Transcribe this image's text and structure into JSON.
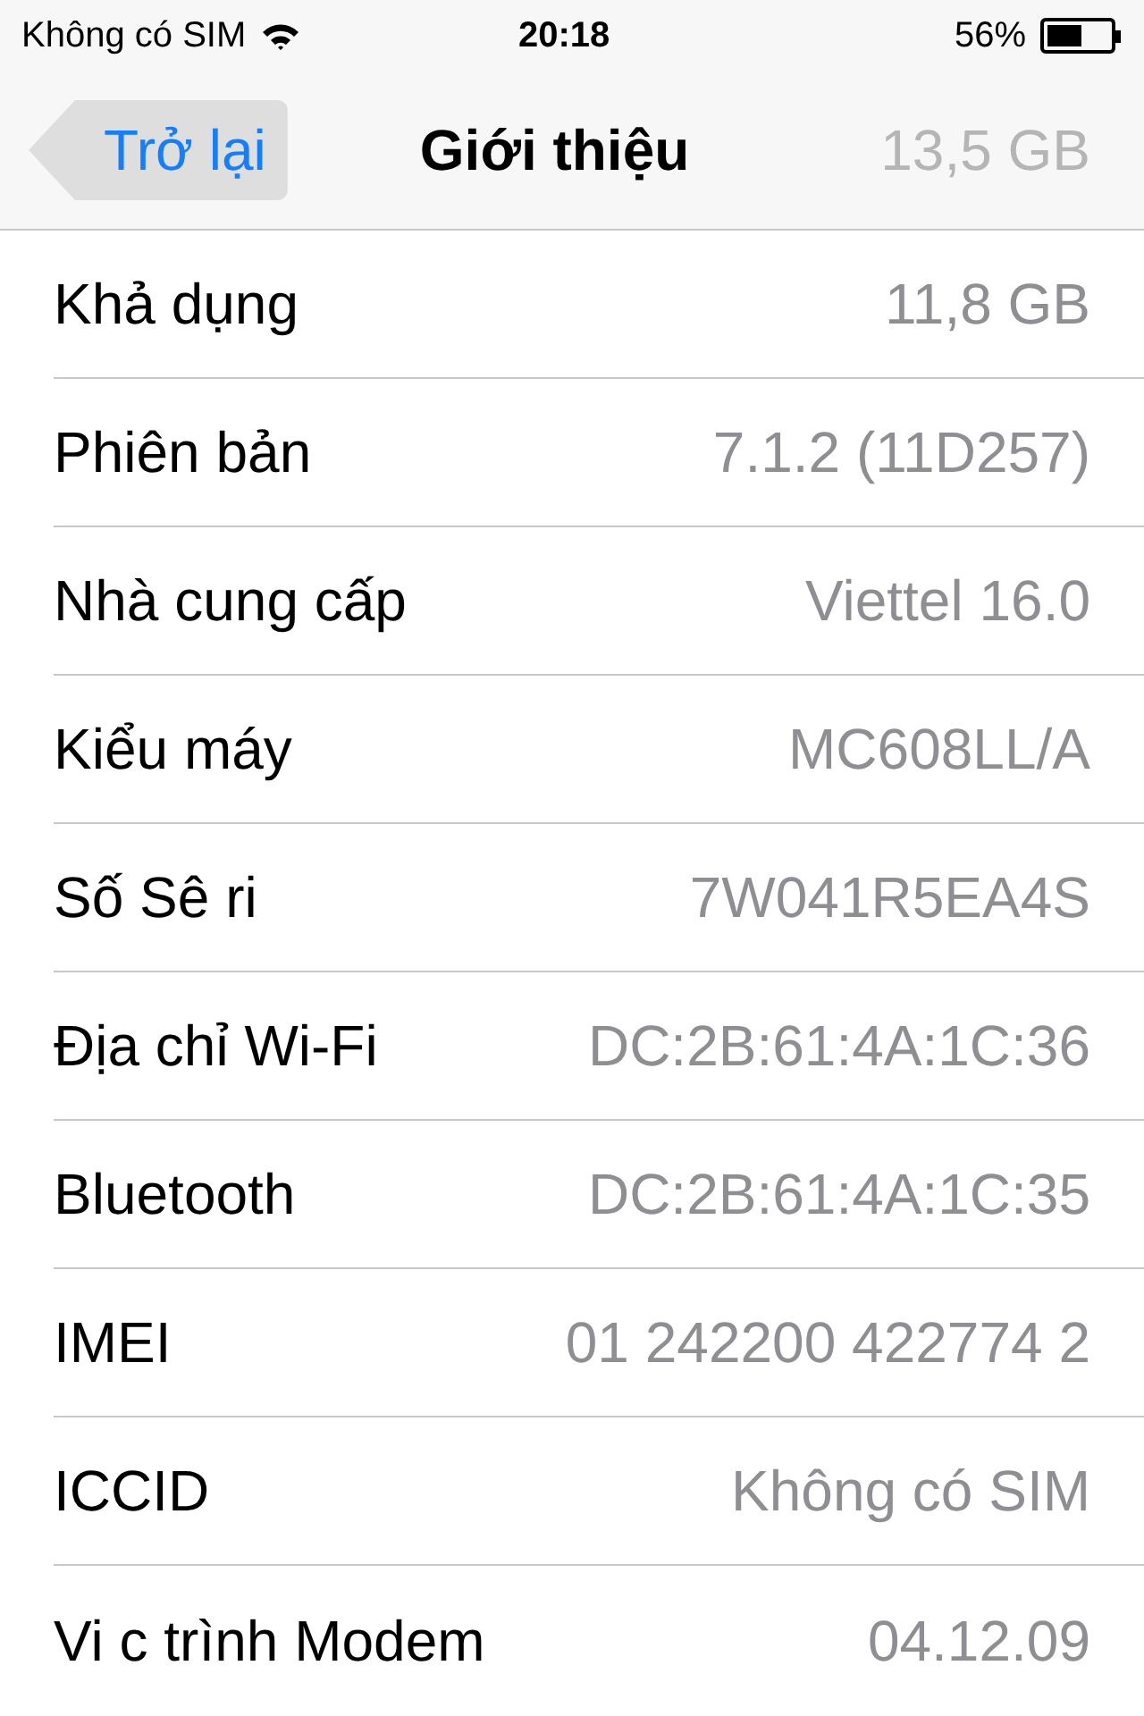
{
  "status_bar": {
    "carrier": "Không có SIM",
    "time": "20:18",
    "battery": "56%"
  },
  "nav_bar": {
    "back": "Trở lại",
    "title": "Giới thiệu",
    "faded_value": "13,5 GB"
  },
  "rows": [
    {
      "label": "Khả dụng",
      "value": "11,8 GB"
    },
    {
      "label": "Phiên bản",
      "value": "7.1.2 (11D257)"
    },
    {
      "label": "Nhà cung cấp",
      "value": "Viettel 16.0"
    },
    {
      "label": "Kiểu máy",
      "value": "MC608LL/A"
    },
    {
      "label": "Số Sê ri",
      "value": "7W041R5EA4S"
    },
    {
      "label": "Địa chỉ Wi-Fi",
      "value": "DC:2B:61:4A:1C:36"
    },
    {
      "label": "Bluetooth",
      "value": "DC:2B:61:4A:1C:35"
    },
    {
      "label": "IMEI",
      "value": "01 242200 422774 2"
    },
    {
      "label": "ICCID",
      "value": "Không có SIM"
    },
    {
      "label": "Vi c trình Modem",
      "value": "04.12.09"
    }
  ]
}
